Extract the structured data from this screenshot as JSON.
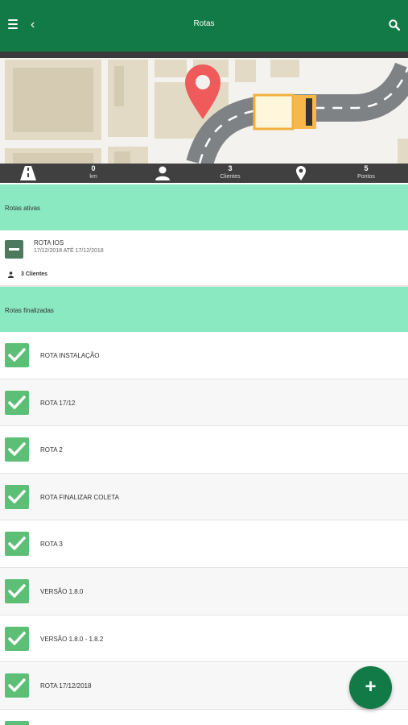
{
  "header": {
    "title": "Rotas",
    "back_glyph": "‹"
  },
  "stats": {
    "distance_value": "0",
    "distance_unit": "km",
    "clients_value": "3",
    "clients_label": "Clientes",
    "points_value": "5",
    "points_label": "Pontos"
  },
  "active": {
    "section_title": "Rotas ativas",
    "route_name": "ROTA IOS",
    "route_dates": "17/12/2018 ATÉ 17/12/2018",
    "clients_text": "3 Clientes"
  },
  "finished": {
    "section_title": "Rotas finalizadas",
    "items": [
      {
        "label": "ROTA INSTALAÇÃO"
      },
      {
        "label": "ROTA 17/12"
      },
      {
        "label": "ROTA 2"
      },
      {
        "label": "ROTA FINALIZAR COLETA"
      },
      {
        "label": "ROTA 3"
      },
      {
        "label": "VERSÃO 1.8.0"
      },
      {
        "label": "VERSÃO 1.8.0 - 1.8.2"
      },
      {
        "label": "ROTA 17/12/2018"
      },
      {
        "label": ""
      }
    ]
  },
  "fab": {
    "label": "+"
  },
  "colors": {
    "primary": "#127a46",
    "section": "#8ae9c1",
    "check": "#5cbf75",
    "pin": "#ef5a5a"
  }
}
